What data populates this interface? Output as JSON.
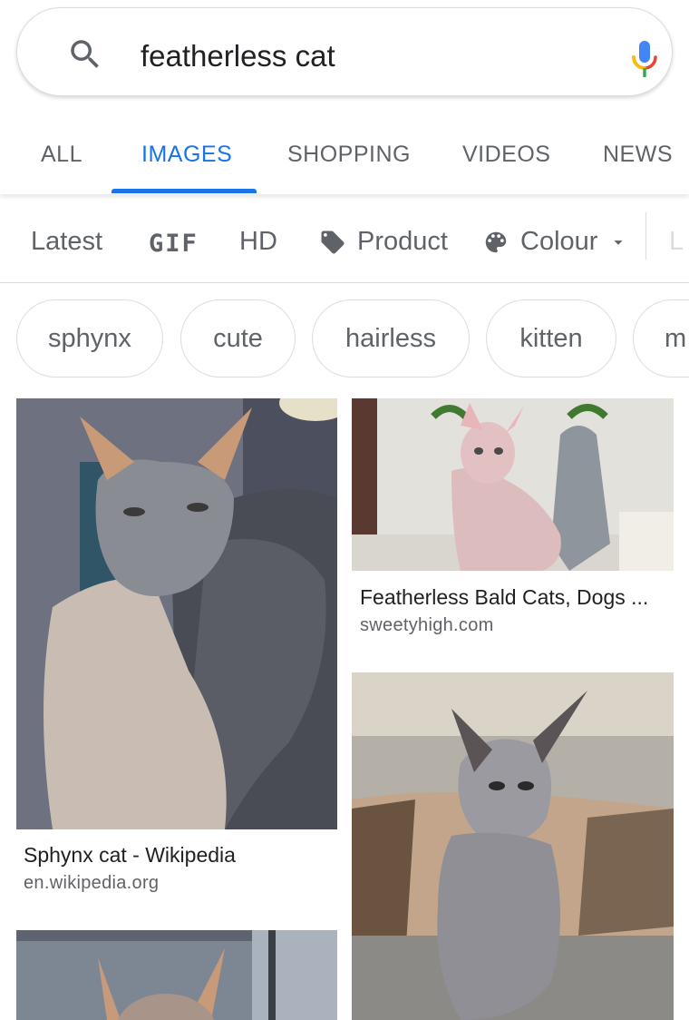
{
  "search": {
    "query": "featherless cat"
  },
  "tabs": [
    {
      "label": "ALL"
    },
    {
      "label": "IMAGES"
    },
    {
      "label": "SHOPPING"
    },
    {
      "label": "VIDEOS"
    },
    {
      "label": "NEWS"
    }
  ],
  "filters": [
    {
      "label": "Latest"
    },
    {
      "label": "GIF"
    },
    {
      "label": "HD"
    },
    {
      "label": "Product",
      "icon": "tag-icon"
    },
    {
      "label": "Colour",
      "icon": "palette-icon"
    }
  ],
  "chips": [
    {
      "label": "sphynx"
    },
    {
      "label": "cute"
    },
    {
      "label": "hairless"
    },
    {
      "label": "kitten"
    },
    {
      "label": "m"
    }
  ],
  "results": [
    {
      "title": "Sphynx cat - Wikipedia",
      "site": "en.wikipedia.org"
    },
    {
      "title": "Featherless Bald Cats, Dogs ...",
      "site": "sweetyhigh.com"
    }
  ],
  "colors": {
    "accent": "#1a73e8",
    "text_secondary": "#5f6368",
    "border": "#dadce0"
  }
}
